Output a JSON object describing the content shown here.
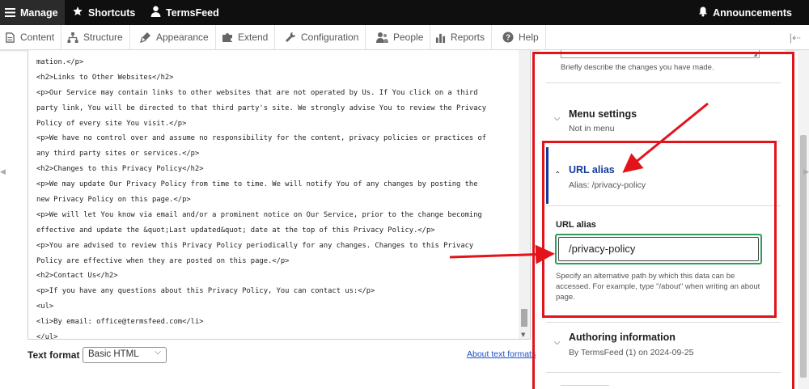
{
  "toolbar": {
    "manage": "Manage",
    "shortcuts": "Shortcuts",
    "site": "TermsFeed",
    "announcements": "Announcements"
  },
  "tray": {
    "items": [
      {
        "label": "Content",
        "icon": "content-icon"
      },
      {
        "label": "Structure",
        "icon": "structure-icon"
      },
      {
        "label": "Appearance",
        "icon": "appearance-icon"
      },
      {
        "label": "Extend",
        "icon": "extend-icon"
      },
      {
        "label": "Configuration",
        "icon": "configuration-icon"
      },
      {
        "label": "People",
        "icon": "people-icon"
      },
      {
        "label": "Reports",
        "icon": "reports-icon"
      },
      {
        "label": "Help",
        "icon": "help-icon"
      }
    ]
  },
  "editor": {
    "lines": [
      "mation.</p>",
      "<h2>Links to Other Websites</h2>",
      "<p>Our Service may contain links to other websites that are not operated by Us. If You click on a third",
      "party link, You will be directed to that third party's site. We strongly advise You to review the Privacy",
      "Policy of every site You visit.</p>",
      "<p>We have no control over and assume no responsibility for the content, privacy policies or practices of",
      "any third party sites or services.</p>",
      "<h2>Changes to this Privacy Policy</h2>",
      "<p>We may update Our Privacy Policy from time to time. We will notify You of any changes by posting the",
      "new Privacy Policy on this page.</p>",
      "<p>We will let You know via email and/or a prominent notice on Our Service, prior to the change becoming",
      "effective and update the &quot;Last updated&quot; date at the top of this Privacy Policy.</p>",
      "<p>You are advised to review this Privacy Policy periodically for any changes. Changes to this Privacy",
      "Policy are effective when they are posted on this page.</p>",
      "<h2>Contact Us</h2>",
      "<p>If you have any questions about this Privacy Policy, You can contact us:</p>",
      "<ul>",
      "<li>By email: office@termsfeed.com</li>",
      "</ul>"
    ]
  },
  "text_format": {
    "label": "Text format",
    "value": "Basic HTML",
    "help_link": "About text formats"
  },
  "sidebar": {
    "revision_hint": "Briefly describe the changes you have made.",
    "menu_settings": {
      "title": "Menu settings",
      "summary": "Not in menu"
    },
    "url_alias": {
      "title": "URL alias",
      "summary": "Alias: /privacy-policy",
      "field_label": "URL alias",
      "value": "/privacy-policy",
      "description": "Specify an alternative path by which this data can be accessed. For example, type \"/about\" when writing an about page."
    },
    "authoring": {
      "title": "Authoring information",
      "summary": "By TermsFeed (1) on 2024-09-25"
    }
  },
  "colors": {
    "annotation_red": "#e3131b",
    "focus_green": "#2e9e5b",
    "active_blue": "#123a9c",
    "toolbar_black": "#0f0f0f"
  }
}
